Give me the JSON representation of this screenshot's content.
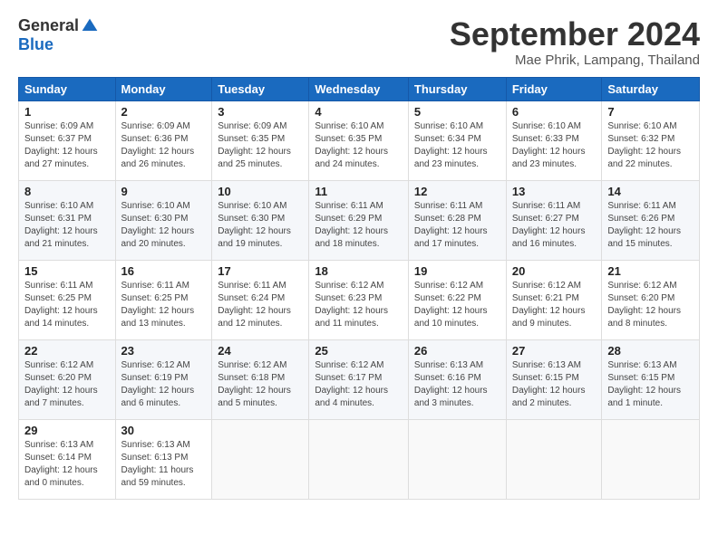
{
  "logo": {
    "general": "General",
    "blue": "Blue"
  },
  "header": {
    "month": "September 2024",
    "location": "Mae Phrik, Lampang, Thailand"
  },
  "weekdays": [
    "Sunday",
    "Monday",
    "Tuesday",
    "Wednesday",
    "Thursday",
    "Friday",
    "Saturday"
  ],
  "weeks": [
    [
      {
        "day": "1",
        "sunrise": "6:09 AM",
        "sunset": "6:37 PM",
        "daylight": "12 hours and 27 minutes."
      },
      {
        "day": "2",
        "sunrise": "6:09 AM",
        "sunset": "6:36 PM",
        "daylight": "12 hours and 26 minutes."
      },
      {
        "day": "3",
        "sunrise": "6:09 AM",
        "sunset": "6:35 PM",
        "daylight": "12 hours and 25 minutes."
      },
      {
        "day": "4",
        "sunrise": "6:10 AM",
        "sunset": "6:35 PM",
        "daylight": "12 hours and 24 minutes."
      },
      {
        "day": "5",
        "sunrise": "6:10 AM",
        "sunset": "6:34 PM",
        "daylight": "12 hours and 23 minutes."
      },
      {
        "day": "6",
        "sunrise": "6:10 AM",
        "sunset": "6:33 PM",
        "daylight": "12 hours and 23 minutes."
      },
      {
        "day": "7",
        "sunrise": "6:10 AM",
        "sunset": "6:32 PM",
        "daylight": "12 hours and 22 minutes."
      }
    ],
    [
      {
        "day": "8",
        "sunrise": "6:10 AM",
        "sunset": "6:31 PM",
        "daylight": "12 hours and 21 minutes."
      },
      {
        "day": "9",
        "sunrise": "6:10 AM",
        "sunset": "6:30 PM",
        "daylight": "12 hours and 20 minutes."
      },
      {
        "day": "10",
        "sunrise": "6:10 AM",
        "sunset": "6:30 PM",
        "daylight": "12 hours and 19 minutes."
      },
      {
        "day": "11",
        "sunrise": "6:11 AM",
        "sunset": "6:29 PM",
        "daylight": "12 hours and 18 minutes."
      },
      {
        "day": "12",
        "sunrise": "6:11 AM",
        "sunset": "6:28 PM",
        "daylight": "12 hours and 17 minutes."
      },
      {
        "day": "13",
        "sunrise": "6:11 AM",
        "sunset": "6:27 PM",
        "daylight": "12 hours and 16 minutes."
      },
      {
        "day": "14",
        "sunrise": "6:11 AM",
        "sunset": "6:26 PM",
        "daylight": "12 hours and 15 minutes."
      }
    ],
    [
      {
        "day": "15",
        "sunrise": "6:11 AM",
        "sunset": "6:25 PM",
        "daylight": "12 hours and 14 minutes."
      },
      {
        "day": "16",
        "sunrise": "6:11 AM",
        "sunset": "6:25 PM",
        "daylight": "12 hours and 13 minutes."
      },
      {
        "day": "17",
        "sunrise": "6:11 AM",
        "sunset": "6:24 PM",
        "daylight": "12 hours and 12 minutes."
      },
      {
        "day": "18",
        "sunrise": "6:12 AM",
        "sunset": "6:23 PM",
        "daylight": "12 hours and 11 minutes."
      },
      {
        "day": "19",
        "sunrise": "6:12 AM",
        "sunset": "6:22 PM",
        "daylight": "12 hours and 10 minutes."
      },
      {
        "day": "20",
        "sunrise": "6:12 AM",
        "sunset": "6:21 PM",
        "daylight": "12 hours and 9 minutes."
      },
      {
        "day": "21",
        "sunrise": "6:12 AM",
        "sunset": "6:20 PM",
        "daylight": "12 hours and 8 minutes."
      }
    ],
    [
      {
        "day": "22",
        "sunrise": "6:12 AM",
        "sunset": "6:20 PM",
        "daylight": "12 hours and 7 minutes."
      },
      {
        "day": "23",
        "sunrise": "6:12 AM",
        "sunset": "6:19 PM",
        "daylight": "12 hours and 6 minutes."
      },
      {
        "day": "24",
        "sunrise": "6:12 AM",
        "sunset": "6:18 PM",
        "daylight": "12 hours and 5 minutes."
      },
      {
        "day": "25",
        "sunrise": "6:12 AM",
        "sunset": "6:17 PM",
        "daylight": "12 hours and 4 minutes."
      },
      {
        "day": "26",
        "sunrise": "6:13 AM",
        "sunset": "6:16 PM",
        "daylight": "12 hours and 3 minutes."
      },
      {
        "day": "27",
        "sunrise": "6:13 AM",
        "sunset": "6:15 PM",
        "daylight": "12 hours and 2 minutes."
      },
      {
        "day": "28",
        "sunrise": "6:13 AM",
        "sunset": "6:15 PM",
        "daylight": "12 hours and 1 minute."
      }
    ],
    [
      {
        "day": "29",
        "sunrise": "6:13 AM",
        "sunset": "6:14 PM",
        "daylight": "12 hours and 0 minutes."
      },
      {
        "day": "30",
        "sunrise": "6:13 AM",
        "sunset": "6:13 PM",
        "daylight": "11 hours and 59 minutes."
      },
      null,
      null,
      null,
      null,
      null
    ]
  ]
}
